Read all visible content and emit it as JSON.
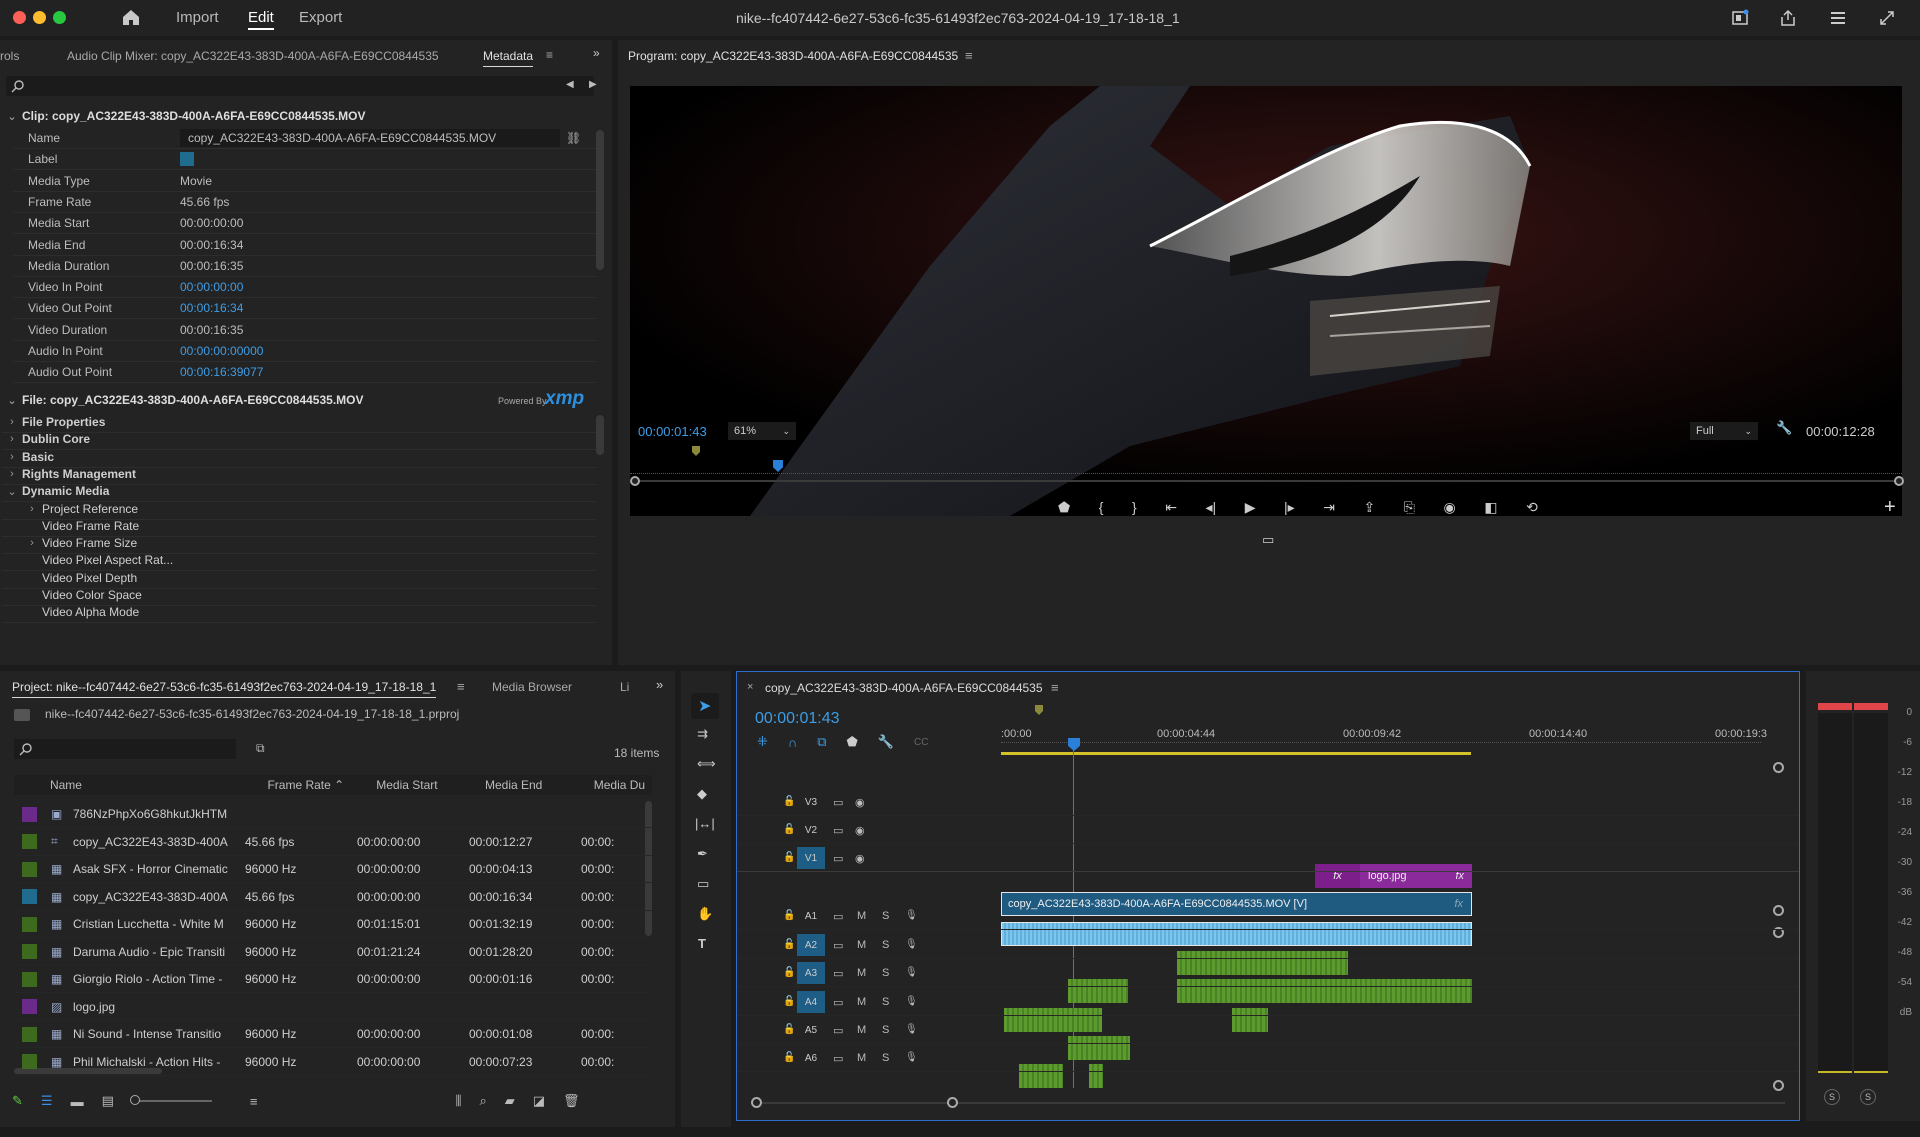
{
  "titlebar": {
    "nav": [
      "Import",
      "Edit",
      "Export"
    ],
    "active": "Edit",
    "project_title": "nike--fc407442-6e27-53c6-fc35-61493f2ec763-2024-04-19_17-18-18_1"
  },
  "source_panel": {
    "tabs": [
      "rols",
      "Audio Clip Mixer: copy_AC322E43-383D-400A-A6FA-E69CC0844535",
      "Metadata"
    ],
    "active_tab": "Metadata",
    "search_placeholder": "",
    "clip_header": "Clip:  copy_AC322E43-383D-400A-A6FA-E69CC0844535.MOV",
    "clip_rows": [
      {
        "label": "Name",
        "value": "copy_AC322E43-383D-400A-A6FA-E69CC0844535.MOV",
        "link": false
      },
      {
        "label": "Label",
        "value": "",
        "link": false
      },
      {
        "label": "Media Type",
        "value": "Movie",
        "link": false
      },
      {
        "label": "Frame Rate",
        "value": "45.66 fps",
        "link": false
      },
      {
        "label": "Media Start",
        "value": "00:00:00:00",
        "link": false
      },
      {
        "label": "Media End",
        "value": "00:00:16:34",
        "link": false
      },
      {
        "label": "Media Duration",
        "value": "00:00:16:35",
        "link": false
      },
      {
        "label": "Video In Point",
        "value": "00:00:00:00",
        "link": true
      },
      {
        "label": "Video Out Point",
        "value": "00:00:16:34",
        "link": true
      },
      {
        "label": "Video Duration",
        "value": "00:00:16:35",
        "link": false
      },
      {
        "label": "Audio In Point",
        "value": "00:00:00:00000",
        "link": true
      },
      {
        "label": "Audio Out Point",
        "value": "00:00:16:39077",
        "link": true
      }
    ],
    "file_header": "File:  copy_AC322E43-383D-400A-A6FA-E69CC0844535.MOV",
    "powered_by": "Powered By",
    "xmp": "xmp",
    "file_rows": [
      {
        "label": "File Properties",
        "level": 0,
        "expanded": false,
        "bold": true
      },
      {
        "label": "Dublin Core",
        "level": 0,
        "expanded": false,
        "bold": true
      },
      {
        "label": "Basic",
        "level": 0,
        "expanded": false,
        "bold": true
      },
      {
        "label": "Rights Management",
        "level": 0,
        "expanded": false,
        "bold": true
      },
      {
        "label": "Dynamic Media",
        "level": 0,
        "expanded": true,
        "bold": true
      },
      {
        "label": "Project Reference",
        "level": 1,
        "expanded": false,
        "bold": false
      },
      {
        "label": "Video Frame Rate",
        "level": 1,
        "expanded": null,
        "bold": false
      },
      {
        "label": "Video Frame Size",
        "level": 1,
        "expanded": false,
        "bold": false
      },
      {
        "label": "Video Pixel Aspect Rat...",
        "level": 1,
        "expanded": null,
        "bold": false
      },
      {
        "label": "Video Pixel Depth",
        "level": 1,
        "expanded": null,
        "bold": false
      },
      {
        "label": "Video Color Space",
        "level": 1,
        "expanded": null,
        "bold": false
      },
      {
        "label": "Video Alpha Mode",
        "level": 1,
        "expanded": null,
        "bold": false
      }
    ]
  },
  "program": {
    "title": "Program: copy_AC322E43-383D-400A-A6FA-E69CC0844535",
    "timecode": "00:00:01:43",
    "zoom": "61%",
    "quality": "Full",
    "duration": "00:00:12:28"
  },
  "project": {
    "tabs": [
      "Project: nike--fc407442-6e27-53c6-fc35-61493f2ec763-2024-04-19_17-18-18_1",
      "Media Browser",
      "Li"
    ],
    "file": "nike--fc407442-6e27-53c6-fc35-61493f2ec763-2024-04-19_17-18-18_1.prproj",
    "items_count": "18 items",
    "columns": [
      "Name",
      "Frame Rate",
      "Media Start",
      "Media End",
      "Media Du"
    ],
    "rows": [
      {
        "color": "#6a2a8a",
        "icon": "file",
        "name": "786NzPhpXo6G8hkutJkHTM",
        "fps": "",
        "start": "",
        "end": "",
        "dur": ""
      },
      {
        "color": "#3e6a1e",
        "icon": "sequence",
        "name": "copy_AC322E43-383D-400A",
        "fps": "45.66 fps",
        "start": "00:00:00:00",
        "end": "00:00:12:27",
        "dur": "00:00:"
      },
      {
        "color": "#3e6a1e",
        "icon": "audio",
        "name": "Asak SFX - Horror Cinematic",
        "fps": "96000 Hz",
        "start": "00:00:00:00",
        "end": "00:00:04:13",
        "dur": "00:00:"
      },
      {
        "color": "#1f6c8e",
        "icon": "video",
        "name": "copy_AC322E43-383D-400A",
        "fps": "45.66 fps",
        "start": "00:00:00:00",
        "end": "00:00:16:34",
        "dur": "00:00:"
      },
      {
        "color": "#3e6a1e",
        "icon": "audio",
        "name": "Cristian Lucchetta - White M",
        "fps": "96000 Hz",
        "start": "00:01:15:01",
        "end": "00:01:32:19",
        "dur": "00:00:"
      },
      {
        "color": "#3e6a1e",
        "icon": "audio",
        "name": "Daruma Audio - Epic Transiti",
        "fps": "96000 Hz",
        "start": "00:01:21:24",
        "end": "00:01:28:20",
        "dur": "00:00:"
      },
      {
        "color": "#3e6a1e",
        "icon": "audio",
        "name": "Giorgio Riolo - Action Time -",
        "fps": "96000 Hz",
        "start": "00:00:00:00",
        "end": "00:00:01:16",
        "dur": "00:00:"
      },
      {
        "color": "#6a2a8a",
        "icon": "image",
        "name": "logo.jpg",
        "fps": "",
        "start": "",
        "end": "",
        "dur": ""
      },
      {
        "color": "#3e6a1e",
        "icon": "audio",
        "name": "Ni Sound - Intense Transitio",
        "fps": "96000 Hz",
        "start": "00:00:00:00",
        "end": "00:00:01:08",
        "dur": "00:00:"
      },
      {
        "color": "#3e6a1e",
        "icon": "audio",
        "name": "Phil Michalski - Action Hits -",
        "fps": "96000 Hz",
        "start": "00:00:00:00",
        "end": "00:00:07:23",
        "dur": "00:00:"
      }
    ]
  },
  "timeline": {
    "title": "copy_AC322E43-383D-400A-A6FA-E69CC0844535",
    "timecode": "00:00:01:43",
    "ruler": [
      ":00:00",
      "00:00:04:44",
      "00:00:09:42",
      "00:00:14:40",
      "00:00:19:3"
    ],
    "tracks": [
      {
        "id": "V3",
        "kind": "video",
        "target": false
      },
      {
        "id": "V2",
        "kind": "video",
        "target": false
      },
      {
        "id": "V1",
        "kind": "video",
        "target": true
      },
      {
        "id": "A1",
        "kind": "audio",
        "target": false
      },
      {
        "id": "A2",
        "kind": "audio",
        "target": true
      },
      {
        "id": "A3",
        "kind": "audio",
        "target": true
      },
      {
        "id": "A4",
        "kind": "audio",
        "target": true
      },
      {
        "id": "A5",
        "kind": "audio",
        "target": false
      },
      {
        "id": "A6",
        "kind": "audio",
        "target": false
      }
    ],
    "mute_label": "M",
    "solo_label": "S",
    "clip_v1": "copy_AC322E43-383D-400A-A6FA-E69CC0844535.MOV [V]",
    "clip_v2": "logo.jpg",
    "fx": "fx"
  },
  "meter": {
    "scale": [
      "0",
      "-6",
      "-12",
      "-18",
      "-24",
      "-30",
      "-36",
      "-42",
      "-48",
      "-54",
      "dB"
    ],
    "solo_label": "S"
  }
}
